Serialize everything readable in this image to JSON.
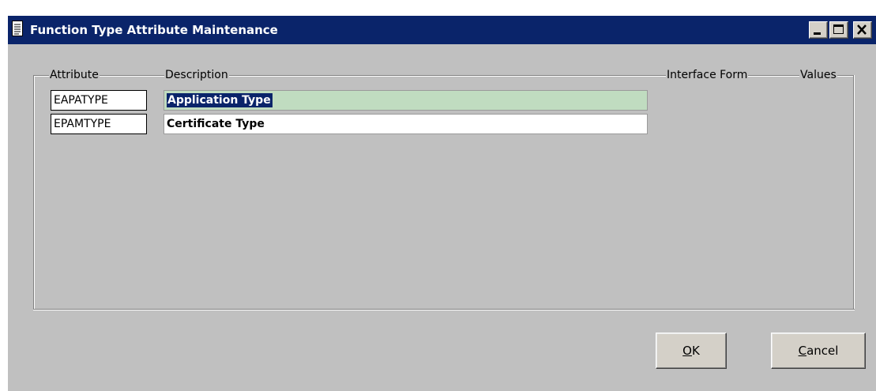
{
  "window": {
    "title": "Function Type Attribute Maintenance",
    "icon": "document-icon",
    "controls": [
      "minimize-icon",
      "maximize-icon",
      "close-icon"
    ]
  },
  "table": {
    "headers": {
      "attribute": "Attribute",
      "description": "Description",
      "interface_form": "Interface Form",
      "values": "Values"
    },
    "rows": [
      {
        "attribute": "EAPATYPE",
        "description": "Application Type",
        "selected": true
      },
      {
        "attribute": "EPAMTYPE",
        "description": "Certificate Type",
        "selected": false
      }
    ]
  },
  "buttons": {
    "ok": {
      "mnemonic": "O",
      "rest": "K"
    },
    "cancel": {
      "mnemonic": "C",
      "rest": "ancel"
    }
  },
  "colors": {
    "titlebar": "#0a246a",
    "dialog_bg": "#c0c0c0",
    "selected_row": "#c0dcc0",
    "selection_highlight": "#0a246a"
  }
}
